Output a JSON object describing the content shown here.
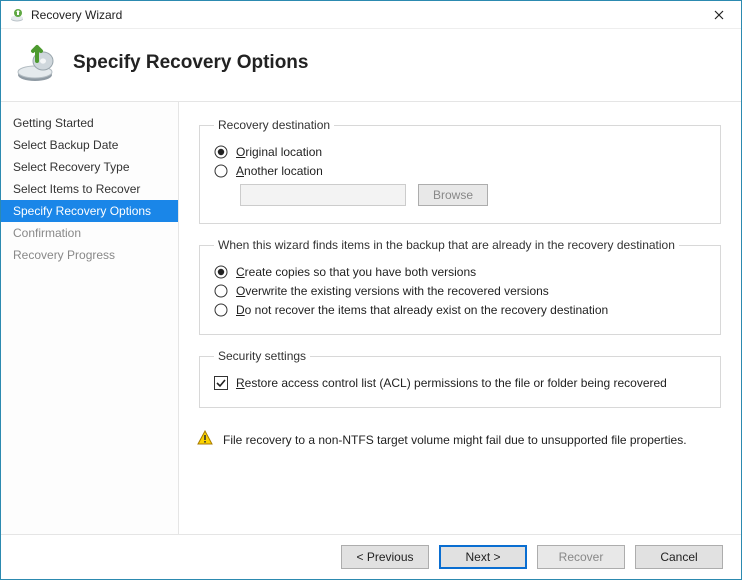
{
  "window": {
    "title": "Recovery Wizard"
  },
  "header": {
    "title": "Specify Recovery Options"
  },
  "steps": [
    {
      "label": "Getting Started",
      "state": "done"
    },
    {
      "label": "Select Backup Date",
      "state": "done"
    },
    {
      "label": "Select Recovery Type",
      "state": "done"
    },
    {
      "label": "Select Items to Recover",
      "state": "done"
    },
    {
      "label": "Specify Recovery Options",
      "state": "active"
    },
    {
      "label": "Confirmation",
      "state": "pending"
    },
    {
      "label": "Recovery Progress",
      "state": "pending"
    }
  ],
  "dest": {
    "legend": "Recovery destination",
    "original": "Original location",
    "another": "Another location",
    "browse": "Browse",
    "selected": "original"
  },
  "conflict": {
    "legend": "When this wizard finds items in the backup that are already in the recovery destination",
    "copies": "Create copies so that you have both versions",
    "overwrite": "Overwrite the existing versions with the recovered versions",
    "skip": "Do not recover the items that already exist on the recovery destination",
    "selected": "copies"
  },
  "security": {
    "legend": "Security settings",
    "acl": "Restore access control list (ACL) permissions to the file or folder being recovered",
    "acl_checked": true
  },
  "warning": "File recovery to a non-NTFS target volume might fail due to unsupported file properties.",
  "footer": {
    "previous": "< Previous",
    "next": "Next >",
    "recover": "Recover",
    "cancel": "Cancel"
  }
}
